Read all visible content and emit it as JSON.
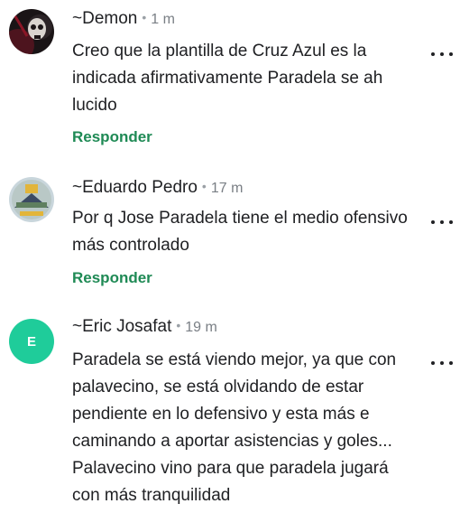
{
  "comments": [
    {
      "author": "~Demon",
      "time": "1 m",
      "text": "Creo que la plantilla de Cruz Azul es la indicada afirmativamente Paradela se ah lucido",
      "reply_label": "Responder",
      "avatar_icon": "skull-avatar-image"
    },
    {
      "author": "~Eduardo Pedro",
      "time": "17 m",
      "text": "Por q Jose Paradela tiene el medio ofensivo más controlado",
      "reply_label": "Responder",
      "avatar_icon": "badge-avatar-image"
    },
    {
      "author": "~Eric Josafat",
      "time": "19 m",
      "text": "Paradela se está viendo mejor, ya que con palavecino, se está olvidando de estar pendiente en lo defensivo y esta más e caminando a aportar asistencias y goles... Palavecino vino para que paradela jugará con más tranquilidad",
      "avatar_letter": "E",
      "avatar_color": "#1fcc9a"
    }
  ],
  "colors": {
    "reply": "#1f8a55",
    "meta": "#7a7f85"
  }
}
